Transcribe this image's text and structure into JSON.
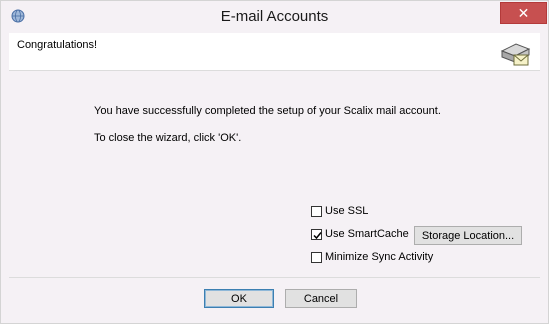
{
  "window": {
    "title": "E-mail Accounts",
    "close_label": "✕",
    "app_icon": "globe-icon"
  },
  "header": {
    "text": "Congratulations!",
    "icon": "mail-server-icon"
  },
  "main": {
    "message_line1": "You have successfully completed the setup of your Scalix mail account.",
    "message_line2": "To close the wizard, click 'OK'."
  },
  "options": {
    "use_ssl": {
      "label": "Use SSL",
      "checked": false
    },
    "use_smartcache": {
      "label": "Use SmartCache",
      "checked": true
    },
    "minimize_sync": {
      "label": "Minimize Sync Activity",
      "checked": false
    },
    "storage_location_label": "Storage Location..."
  },
  "footer": {
    "ok_label": "OK",
    "cancel_label": "Cancel"
  },
  "colors": {
    "close_button": "#c75050",
    "default_button_border": "#3c7fb1"
  }
}
